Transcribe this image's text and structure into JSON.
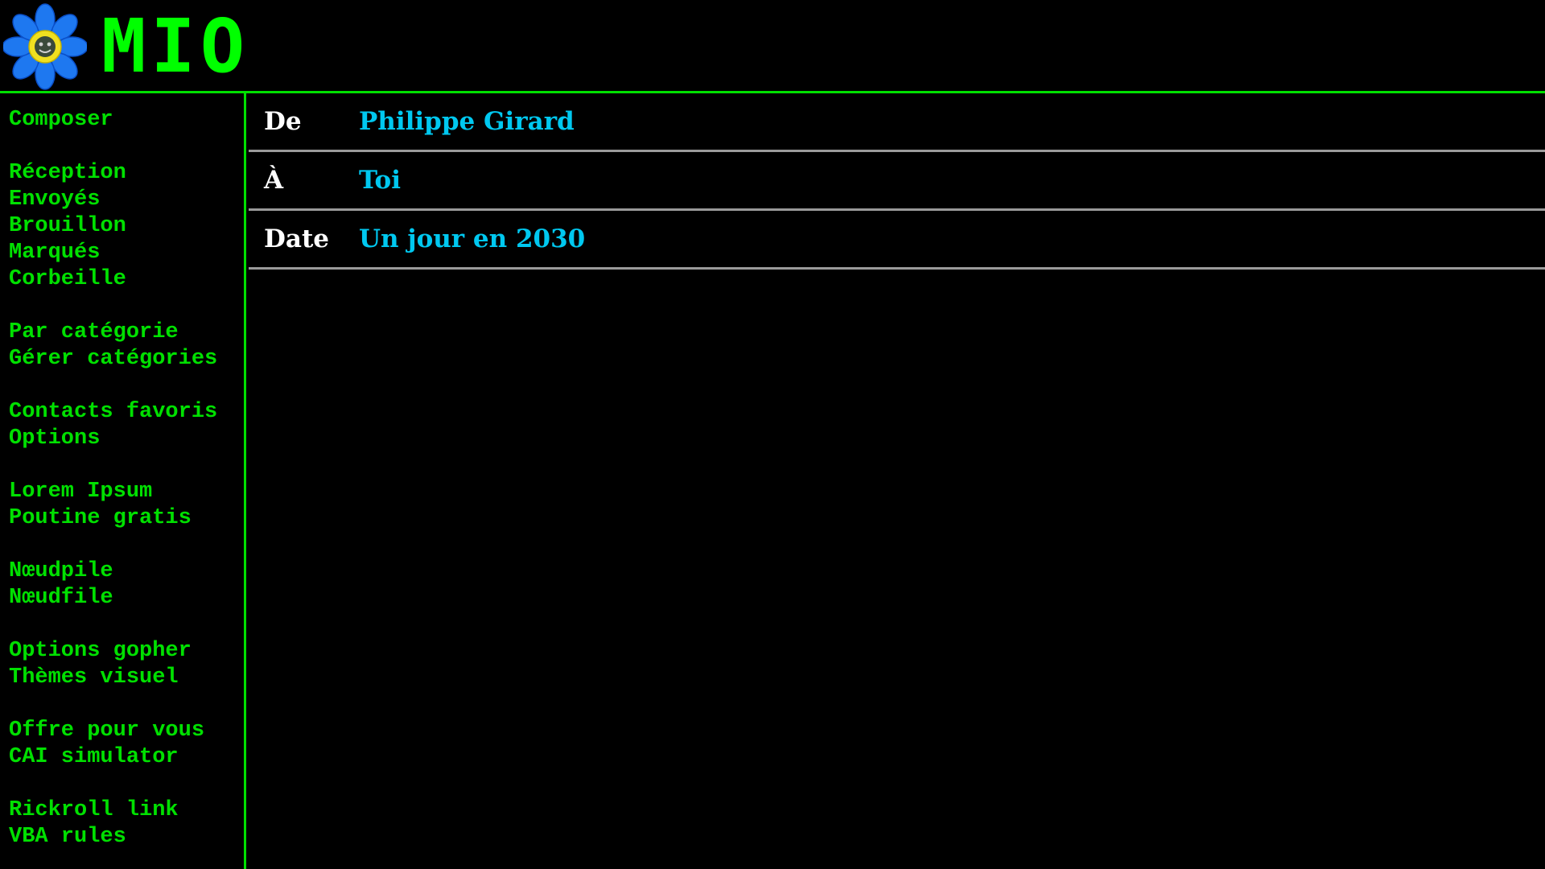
{
  "app": {
    "title": "MIO",
    "logo_icon": "flower-icon"
  },
  "colors": {
    "accent": "#00e000",
    "header_value": "#00c8f0",
    "divider": "#9a9a9a",
    "background": "#000000"
  },
  "sidebar": {
    "groups": [
      [
        "Composer"
      ],
      [
        "Réception",
        "Envoyés",
        "Brouillon",
        "Marqués",
        "Corbeille"
      ],
      [
        "Par catégorie",
        "Gérer catégories"
      ],
      [
        "Contacts favoris",
        "Options"
      ],
      [
        "Lorem Ipsum",
        "Poutine gratis"
      ],
      [
        "Nœudpile",
        "Nœudfile"
      ],
      [
        "Options gopher",
        "Thèmes visuel"
      ],
      [
        "Offre pour vous",
        "CAI simulator"
      ],
      [
        "Rickroll link",
        "VBA rules"
      ]
    ]
  },
  "message": {
    "from_label": "De",
    "from_value": "Philippe Girard",
    "to_label": "À",
    "to_value": "Toi",
    "date_label": "Date",
    "date_value": "Un jour en 2030"
  }
}
